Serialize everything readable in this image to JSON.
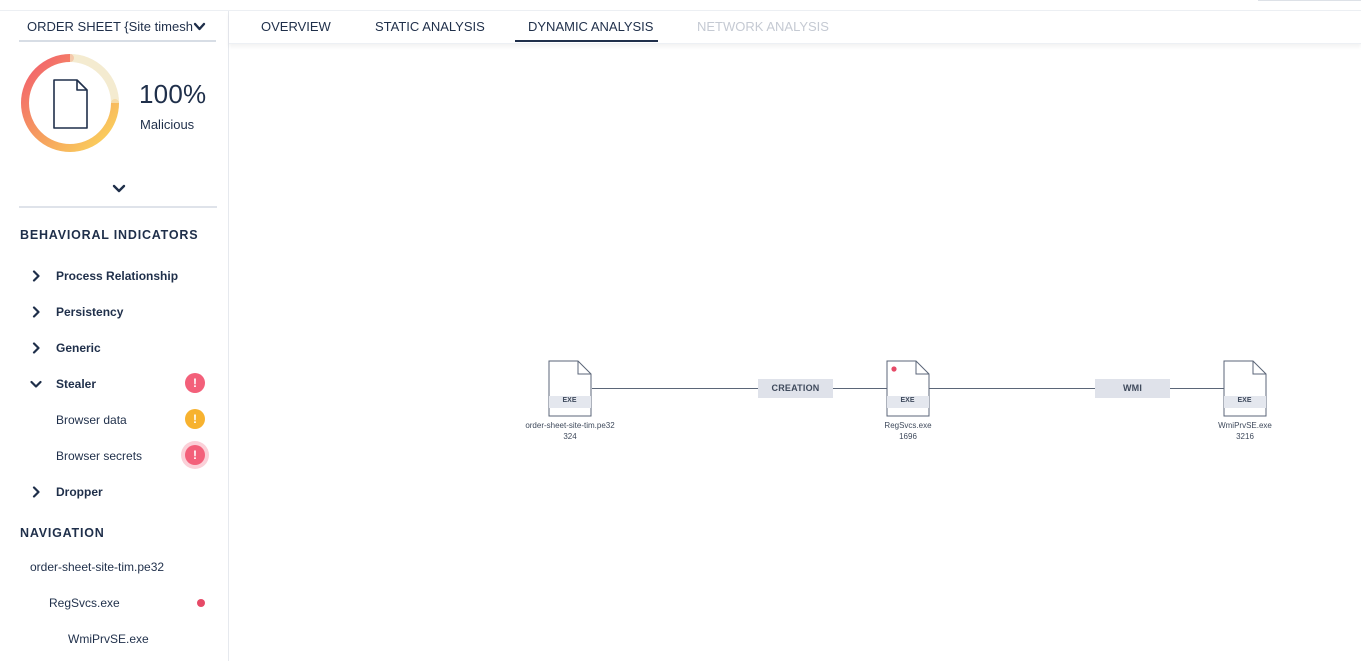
{
  "sample": {
    "name": "ORDER SHEET {Site timesh",
    "score": "100%",
    "verdict": "Malicious"
  },
  "sections": {
    "behavioral": "BEHAVIORAL INDICATORS",
    "navigation": "NAVIGATION"
  },
  "indicators": [
    {
      "label": "Process Relationship",
      "state": "collapsed"
    },
    {
      "label": "Persistency",
      "state": "collapsed"
    },
    {
      "label": "Generic",
      "state": "collapsed"
    },
    {
      "label": "Stealer",
      "state": "expanded",
      "badge": "!",
      "badge_color": "#f3607a"
    },
    {
      "label": "Browser data",
      "badge": "!",
      "badge_color": "#f7b22f"
    },
    {
      "label": "Browser secrets",
      "badge": "!",
      "badge_color": "#f3607a"
    },
    {
      "label": "Dropper",
      "state": "collapsed"
    }
  ],
  "navigation": [
    {
      "label": "order-sheet-site-tim.pe32"
    },
    {
      "label": "RegSvcs.exe",
      "marked": true
    },
    {
      "label": "WmiPrvSE.exe"
    }
  ],
  "tabs": [
    {
      "label": "OVERVIEW"
    },
    {
      "label": "STATIC ANALYSIS"
    },
    {
      "label": "DYNAMIC ANALYSIS",
      "active": true
    },
    {
      "label": "NETWORK ANALYSIS",
      "disabled": true
    }
  ],
  "graph": {
    "nodes": [
      {
        "type": "EXE",
        "name": "order-sheet-site-tim.pe32",
        "pid": "324"
      },
      {
        "type": "EXE",
        "name": "RegSvcs.exe",
        "pid": "1696",
        "marked": true
      },
      {
        "type": "EXE",
        "name": "WmiPrvSE.exe",
        "pid": "3216"
      }
    ],
    "edges": [
      {
        "label": "CREATION"
      },
      {
        "label": "WMI"
      }
    ]
  },
  "colors": {
    "accent": "#1f2f4a",
    "danger": "#f3607a",
    "warning": "#f7b22f",
    "mark": "#e64a67"
  }
}
